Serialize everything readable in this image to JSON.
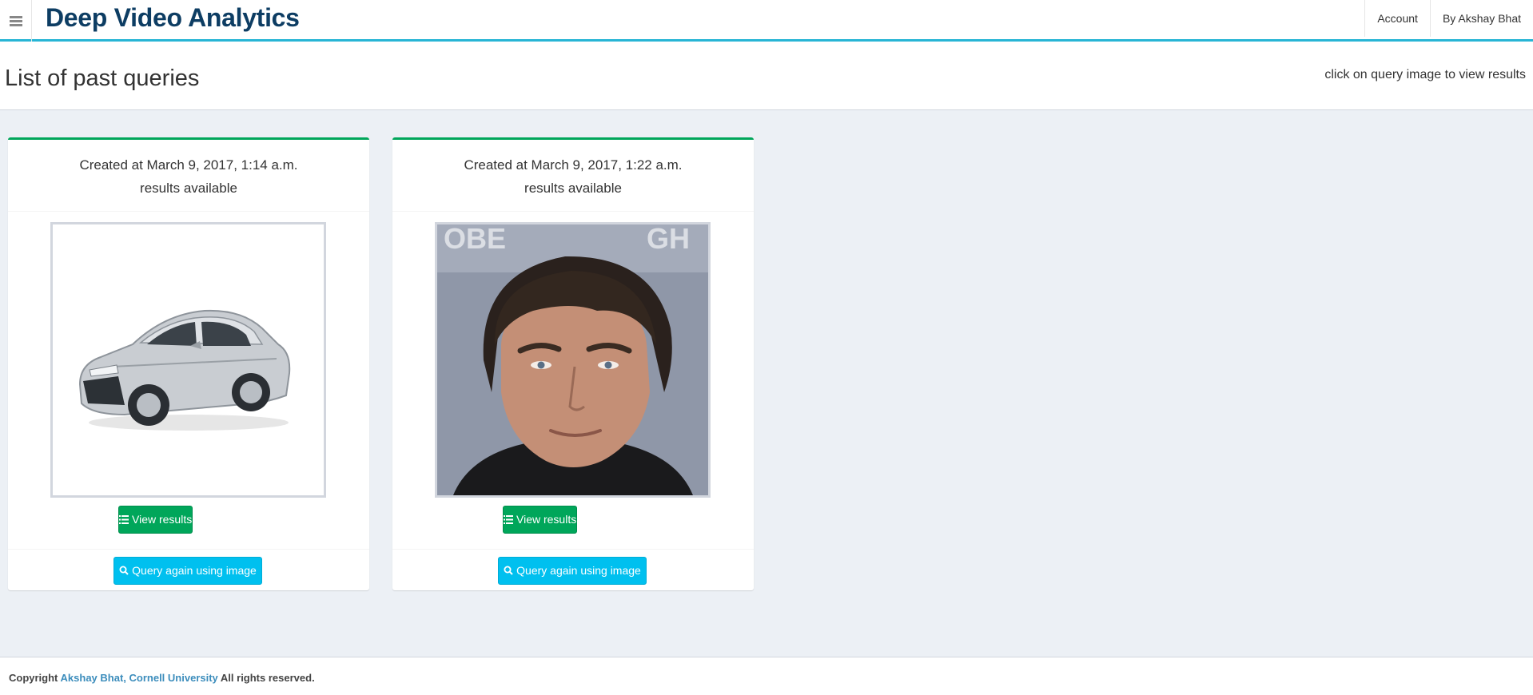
{
  "header": {
    "brand": "Deep Video Analytics",
    "nav": [
      "Account",
      "By Akshay Bhat"
    ]
  },
  "content_header": {
    "title": "List of past queries",
    "hint": "click on query image to view results"
  },
  "queries": [
    {
      "created": "Created at March 9, 2017, 1:14 a.m.",
      "status": "results available",
      "image": "car-image",
      "view_label": "View results",
      "query_again_label": "Query again using image"
    },
    {
      "created": "Created at March 9, 2017, 1:22 a.m.",
      "status": "results available",
      "image": "face-portrait-image",
      "view_label": "View results",
      "query_again_label": "Query again using image"
    }
  ],
  "footer": {
    "prefix": "Copyright",
    "link": "Akshay Bhat, Cornell University",
    "suffix": "All rights reserved."
  },
  "colors": {
    "accent_header": "#27b5d5",
    "brand": "#0d3d63",
    "success": "#00a65a",
    "info": "#00c0ef",
    "background": "#ecf0f5"
  }
}
